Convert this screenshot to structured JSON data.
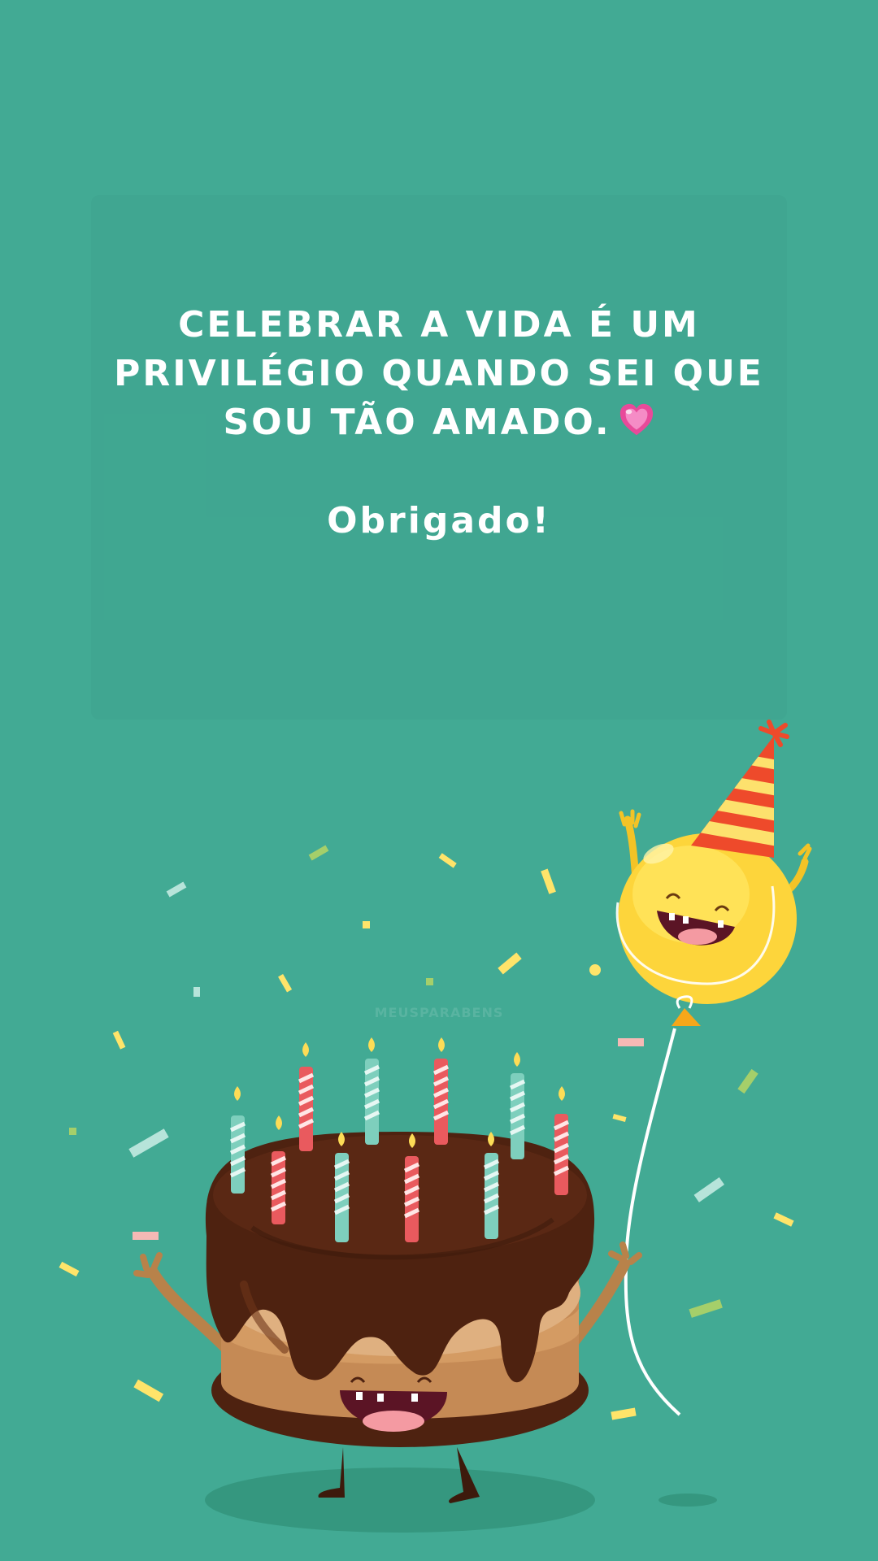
{
  "quote": {
    "lines": [
      "Celebrar a vida é um",
      "privilégio quando sei que",
      "sou tão amado."
    ],
    "thanks": "Obrigado!"
  },
  "watermark": "MEUSPARABENS",
  "icons": [
    "heart-emoji-icon",
    "birthday-cake-illustration",
    "party-balloon-illustration",
    "confetti"
  ],
  "colors": {
    "background": "#42aa94",
    "text": "#ffffff",
    "chocolate": "#4e2210",
    "cake": "#c58a55",
    "balloon": "#fdd53b",
    "hat_red": "#ee4a2b",
    "candle_red": "#e95a5e",
    "candle_teal": "#7ecfbd"
  }
}
